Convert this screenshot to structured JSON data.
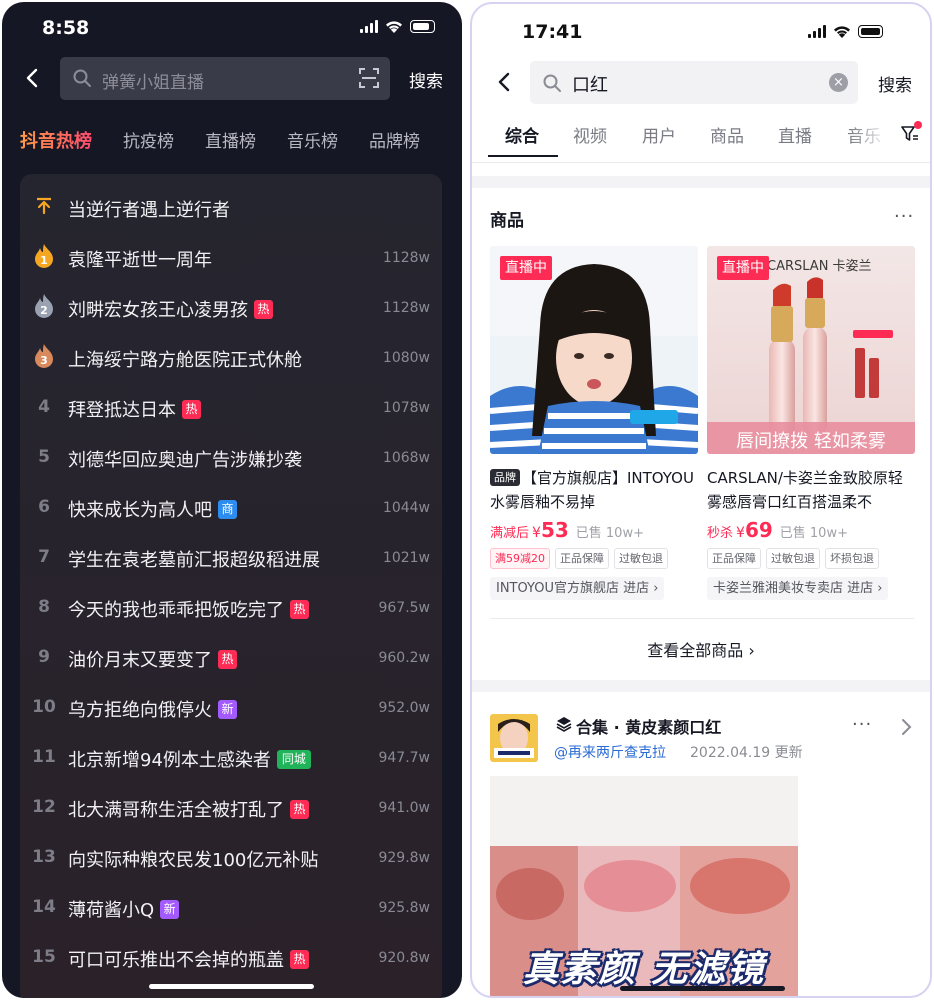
{
  "left": {
    "status": {
      "time": "8:58"
    },
    "search": {
      "placeholder": "弹簧小姐直播",
      "button": "搜索"
    },
    "tabs": [
      {
        "label": "抖音热榜",
        "active": true
      },
      {
        "label": "抗疫榜",
        "active": false
      },
      {
        "label": "直播榜",
        "active": false
      },
      {
        "label": "音乐榜",
        "active": false
      },
      {
        "label": "品牌榜",
        "active": false
      }
    ],
    "ranking": [
      {
        "rank": "",
        "title": "当逆行者遇上逆行者",
        "count": "",
        "badge": "",
        "marker": "pinned-top-icon"
      },
      {
        "rank": "1",
        "title": "袁隆平逝世一周年",
        "count": "1128w",
        "badge": "",
        "marker": "gold-medal-icon"
      },
      {
        "rank": "2",
        "title": "刘畊宏女孩王心凌男孩",
        "count": "1128w",
        "badge": "热",
        "marker": "silver-medal-icon"
      },
      {
        "rank": "3",
        "title": "上海绥宁路方舱医院正式休舱",
        "count": "1080w",
        "badge": "",
        "marker": "bronze-medal-icon"
      },
      {
        "rank": "4",
        "title": "拜登抵达日本",
        "count": "1078w",
        "badge": "热"
      },
      {
        "rank": "5",
        "title": "刘德华回应奥迪广告涉嫌抄袭",
        "count": "1068w",
        "badge": ""
      },
      {
        "rank": "6",
        "title": "快来成长为高人吧",
        "count": "1044w",
        "badge": "商"
      },
      {
        "rank": "7",
        "title": "学生在袁老墓前汇报超级稻进展",
        "count": "1021w",
        "badge": ""
      },
      {
        "rank": "8",
        "title": "今天的我也乖乖把饭吃完了",
        "count": "967.5w",
        "badge": "热"
      },
      {
        "rank": "9",
        "title": "油价月末又要变了",
        "count": "960.2w",
        "badge": "热"
      },
      {
        "rank": "10",
        "title": "乌方拒绝向俄停火",
        "count": "952.0w",
        "badge": "新"
      },
      {
        "rank": "11",
        "title": "北京新增94例本土感染者",
        "count": "947.7w",
        "badge": "同城"
      },
      {
        "rank": "12",
        "title": "北大满哥称生活全被打乱了",
        "count": "941.0w",
        "badge": "热"
      },
      {
        "rank": "13",
        "title": "向实际种粮农民发100亿元补贴",
        "count": "929.8w",
        "badge": ""
      },
      {
        "rank": "14",
        "title": "薄荷酱小Q",
        "count": "925.8w",
        "badge": "新"
      },
      {
        "rank": "15",
        "title": "可口可乐推出不会掉的瓶盖",
        "count": "920.8w",
        "badge": "热"
      }
    ],
    "badge_colors": {
      "热": "#fe2c55",
      "商": "#2d8cf0",
      "新": "#a35bff",
      "同城": "#20b35a"
    }
  },
  "right": {
    "status": {
      "time": "17:41"
    },
    "search": {
      "value": "口红",
      "clear_icon": "×",
      "button": "搜索"
    },
    "tabs": [
      {
        "label": "综合",
        "active": true
      },
      {
        "label": "视频",
        "active": false
      },
      {
        "label": "用户",
        "active": false
      },
      {
        "label": "商品",
        "active": false
      },
      {
        "label": "直播",
        "active": false
      },
      {
        "label": "音乐",
        "active": false
      }
    ],
    "products_section": {
      "title": "商品",
      "more": "···",
      "items": [
        {
          "live_tag": "直播中",
          "brand_tag": "品牌",
          "name": "【官方旗舰店】INTOYOU水雾唇釉不易掉",
          "price_prefix": "满减后",
          "currency": "¥",
          "price": "53",
          "sold": "已售 10w+",
          "tags": [
            "满59减20",
            "正品保障",
            "过敏包退"
          ],
          "store": "INTOYOU官方旗舰店 进店 ›"
        },
        {
          "live_tag": "直播中",
          "image_text": "CARSLAN 卡姿兰",
          "image_banner": "唇间撩拨 轻如柔雾",
          "name": "CARSLAN/卡姿兰金致胶原轻雾感唇膏口红百搭温柔不",
          "price_prefix": "秒杀",
          "currency": "¥",
          "price": "69",
          "sold": "已售 10w+",
          "tags": [
            "正品保障",
            "过敏包退",
            "坏损包退"
          ],
          "store": "卡姿兰雅湘美妆专卖店 进店 ›"
        }
      ],
      "view_all": "查看全部商品 ›"
    },
    "collection": {
      "title": "合集 · 黄皮素颜口红",
      "author": "@再来两斤查克拉",
      "date": "2022.04.19 更新",
      "more": "···",
      "video_caption": "真素颜 无滤镜"
    }
  }
}
